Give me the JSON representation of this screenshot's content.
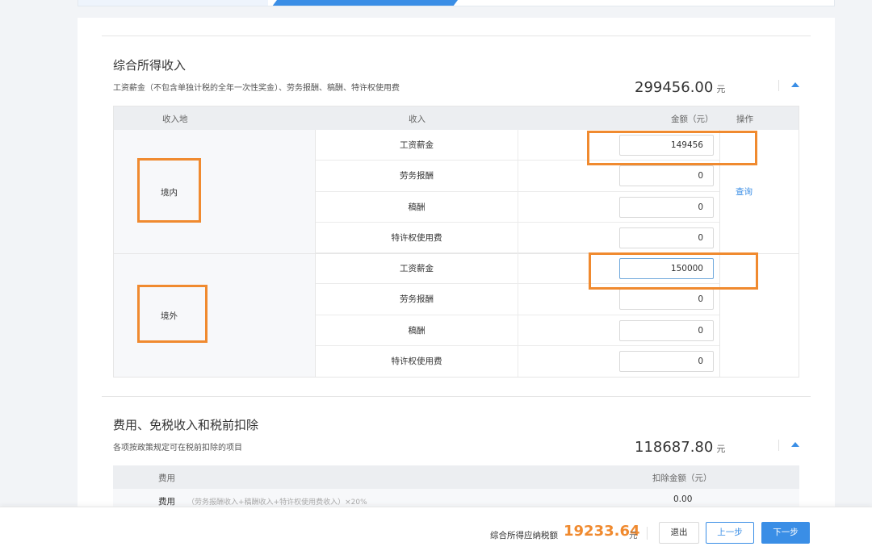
{
  "income_section": {
    "title": "综合所得收入",
    "desc": "工资薪金（不包含单独计税的全年一次性奖金）、劳务报酬、稿酬、特许权使用费",
    "amount": "299456.00",
    "unit": "元",
    "columns": {
      "region": "收入地",
      "income": "收入",
      "amount": "金额（元）",
      "ops": "操作"
    },
    "regions": [
      {
        "name": "境内",
        "rows": [
          {
            "name": "工资薪金",
            "value": "149456"
          },
          {
            "name": "劳务报酬",
            "value": "0"
          },
          {
            "name": "稿酬",
            "value": "0"
          },
          {
            "name": "特许权使用费",
            "value": "0"
          }
        ]
      },
      {
        "name": "境外",
        "rows": [
          {
            "name": "工资薪金",
            "value": "150000"
          },
          {
            "name": "劳务报酬",
            "value": "0"
          },
          {
            "name": "稿酬",
            "value": "0"
          },
          {
            "name": "特许权使用费",
            "value": "0"
          }
        ]
      }
    ],
    "query_link": "查询"
  },
  "deduction_section": {
    "title": "费用、免税收入和税前扣除",
    "desc": "各项按政策规定可在税前扣除的项目",
    "amount": "118687.80",
    "unit": "元",
    "columns": {
      "fee": "费用",
      "deduct": "扣除金额（元）"
    },
    "rows": [
      {
        "label": "费用",
        "formula": "（劳务报酬收入+稿酬收入+特许权使用费收入）×20%",
        "value": "0.00"
      }
    ]
  },
  "footer": {
    "label": "综合所得应纳税额",
    "tax": "19233.64",
    "unit": "元",
    "exit": "退出",
    "prev": "上一步",
    "next": "下一步"
  },
  "colors": {
    "accent": "#3a8ee6",
    "highlight": "#f08a2f"
  },
  "icons": {
    "collapse": "caret-up-icon"
  }
}
